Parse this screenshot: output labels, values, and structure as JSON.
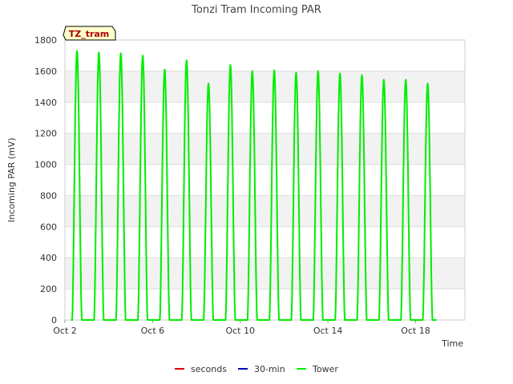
{
  "chart_data": {
    "type": "line",
    "title": "Tonzi Tram Incoming PAR",
    "xlabel": "Time",
    "ylabel": "Incoming PAR (mV)",
    "site_label": "TZ_tram",
    "x_unit": "day of October",
    "xlim": [
      2.0,
      20.25
    ],
    "ylim": [
      0,
      1800
    ],
    "y_ticks": [
      0,
      200,
      400,
      600,
      800,
      1000,
      1200,
      1400,
      1600,
      1800
    ],
    "x_ticks": [
      {
        "value": 2,
        "label": "Oct 2"
      },
      {
        "value": 6,
        "label": "Oct 6"
      },
      {
        "value": 10,
        "label": "Oct 10"
      },
      {
        "value": 14,
        "label": "Oct 14"
      },
      {
        "value": 18,
        "label": "Oct 18"
      }
    ],
    "grid": true,
    "legend_position": "bottom",
    "series": [
      {
        "name": "seconds",
        "color": "#dd0000",
        "points": []
      },
      {
        "name": "30-min",
        "color": "#0000bb",
        "points": []
      },
      {
        "name": "Tower",
        "color": "#00ee00",
        "daily_peaks": [
          {
            "day": 2,
            "peak": 1730
          },
          {
            "day": 3,
            "peak": 1720
          },
          {
            "day": 4,
            "peak": 1715
          },
          {
            "day": 5,
            "peak": 1700
          },
          {
            "day": 6,
            "peak": 1610
          },
          {
            "day": 7,
            "peak": 1670
          },
          {
            "day": 8,
            "peak": 1520
          },
          {
            "day": 9,
            "peak": 1640
          },
          {
            "day": 10,
            "peak": 1600
          },
          {
            "day": 11,
            "peak": 1605
          },
          {
            "day": 12,
            "peak": 1590
          },
          {
            "day": 13,
            "peak": 1600
          },
          {
            "day": 14,
            "peak": 1585
          },
          {
            "day": 15,
            "peak": 1575
          },
          {
            "day": 16,
            "peak": 1545
          },
          {
            "day": 17,
            "peak": 1545
          },
          {
            "day": 18,
            "peak": 1520
          }
        ]
      }
    ]
  }
}
